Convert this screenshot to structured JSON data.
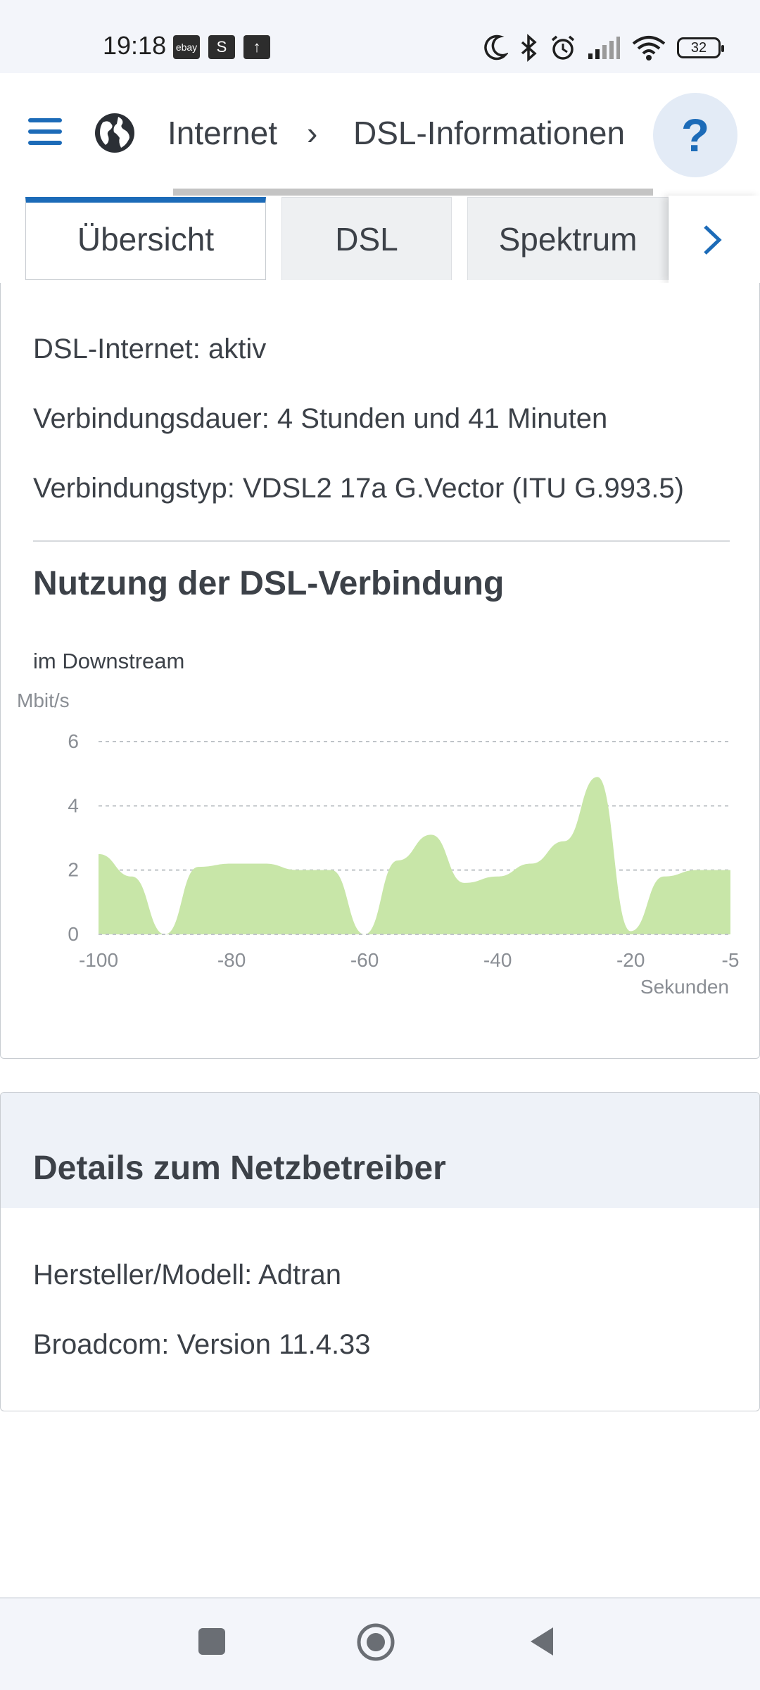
{
  "status_bar": {
    "time": "19:18",
    "app_icons": [
      "ebay",
      "S",
      "↑"
    ],
    "battery": "32",
    "icons": [
      "moon-icon",
      "bluetooth-icon",
      "alarm-icon",
      "signal-icon",
      "wifi-icon",
      "battery-icon"
    ]
  },
  "header": {
    "breadcrumb_root": "Internet",
    "breadcrumb_separator": "›",
    "breadcrumb_current": "DSL-Informationen",
    "help_label": "?"
  },
  "tabs": [
    {
      "label": "Übersicht",
      "active": true
    },
    {
      "label": "DSL",
      "active": false
    },
    {
      "label": "Spektrum",
      "active": false
    }
  ],
  "overview": {
    "dsl_internet": "DSL-Internet: aktiv",
    "duration": "Verbindungsdauer: 4 Stunden und 41 Minuten",
    "type": "Verbindungstyp: VDSL2 17a G.Vector (ITU G.993.5)"
  },
  "usage": {
    "title": "Nutzung der DSL-Verbindung",
    "subtitle": "im Downstream"
  },
  "chart_data": {
    "type": "area",
    "title": "",
    "xlabel": "Sekunden",
    "ylabel": "Mbit/s",
    "ylim": [
      0,
      6
    ],
    "xlim": [
      -100,
      -5
    ],
    "yticks": [
      0,
      2,
      4,
      6
    ],
    "xticks": [
      -100,
      -80,
      -60,
      -40,
      -20,
      -5
    ],
    "grid": "horizontal dotted",
    "color": "#c8e6a8",
    "series": [
      {
        "x": [
          -100,
          -95,
          -90,
          -85,
          -80,
          -75,
          -70,
          -65,
          -60,
          -55,
          -50,
          -45,
          -40,
          -35,
          -30,
          -25,
          -20,
          -15,
          -10,
          -5
        ],
        "values": [
          2.5,
          1.8,
          0.0,
          2.1,
          2.2,
          2.2,
          2.0,
          2.0,
          0.0,
          2.3,
          3.1,
          1.6,
          1.8,
          2.2,
          2.9,
          4.9,
          0.1,
          1.8,
          2.0,
          2.0
        ]
      }
    ]
  },
  "operator": {
    "title": "Details zum Netzbetreiber",
    "manufacturer": "Hersteller/Modell: Adtran",
    "broadcom": "Broadcom: Version 11.4.33"
  },
  "colors": {
    "accent": "#1c6bb8",
    "chart_fill": "#c8e6a8",
    "text": "#3c4148"
  }
}
